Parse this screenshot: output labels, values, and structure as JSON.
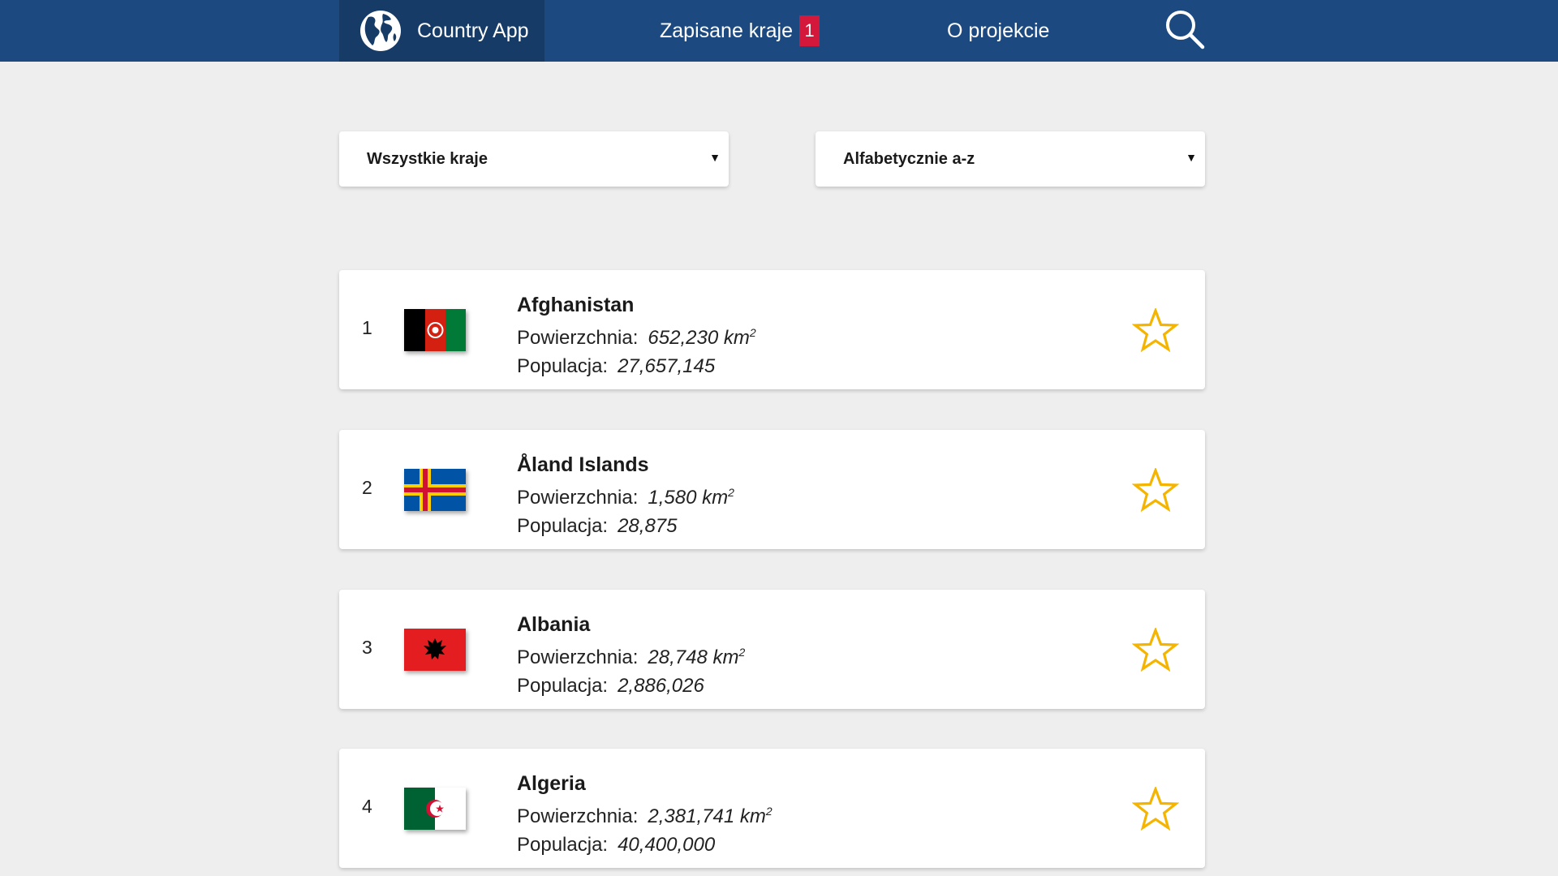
{
  "nav": {
    "brand": "Country App",
    "saved_label": "Zapisane kraje",
    "saved_count": "1",
    "about_label": "O projekcie",
    "search_icon": "search-icon"
  },
  "filters": {
    "region_selected": "Wszystkie kraje",
    "sort_selected": "Alfabetycznie a-z"
  },
  "labels": {
    "area": "Powierzchnia:",
    "population": "Populacja:",
    "area_unit": "km"
  },
  "countries": [
    {
      "index": "1",
      "name": "Afghanistan",
      "area": "652,230",
      "population": "27,657,145",
      "flag": "afghanistan"
    },
    {
      "index": "2",
      "name": "Åland Islands",
      "area": "1,580",
      "population": "28,875",
      "flag": "aland"
    },
    {
      "index": "3",
      "name": "Albania",
      "area": "28,748",
      "population": "2,886,026",
      "flag": "albania"
    },
    {
      "index": "4",
      "name": "Algeria",
      "area": "2,381,741",
      "population": "40,400,000",
      "flag": "algeria"
    }
  ],
  "colors": {
    "navbar": "#1c4a80",
    "brand_bg": "#163b66",
    "badge": "#d3183b",
    "star": "#f5b400",
    "background": "#eeeeee"
  }
}
